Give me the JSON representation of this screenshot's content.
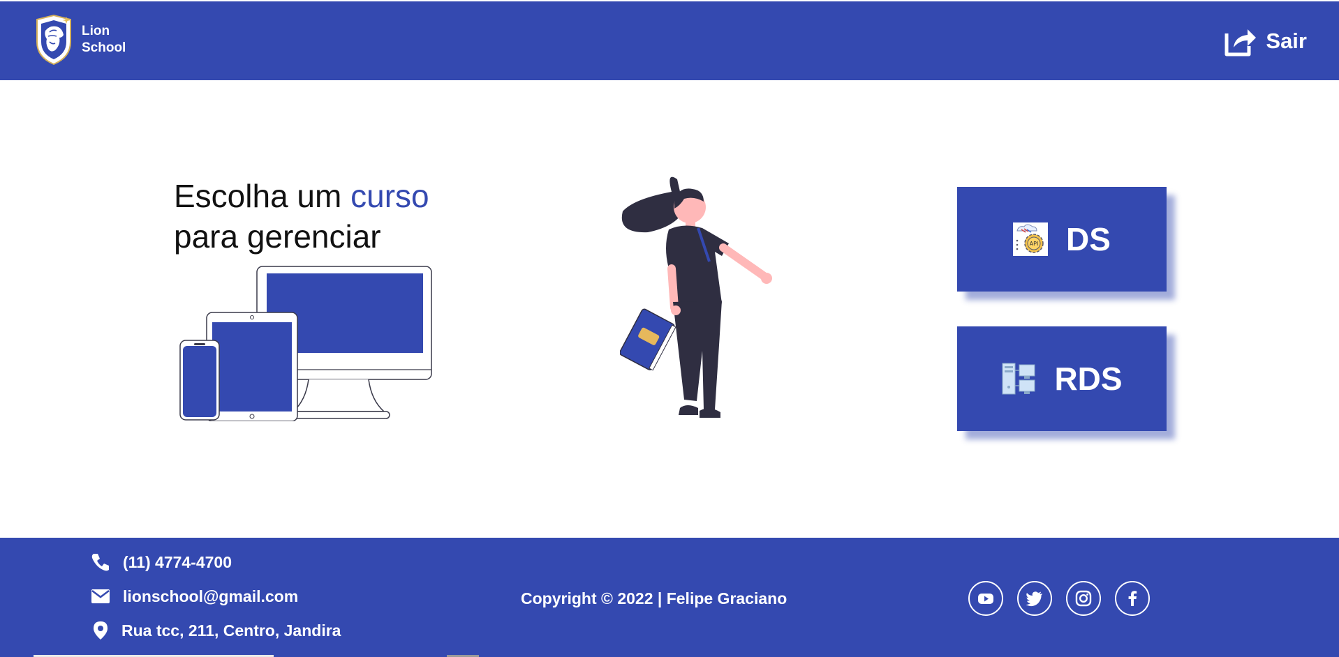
{
  "header": {
    "brand_line1": "Lion",
    "brand_line2": "School",
    "logout_label": "Sair"
  },
  "main": {
    "headline_part1": "Escolha um",
    "headline_accent": "curso",
    "headline_part2": "para gerenciar",
    "courses": [
      {
        "label": "DS",
        "icon": "api-gear-icon"
      },
      {
        "label": "RDS",
        "icon": "server-network-icon"
      }
    ]
  },
  "footer": {
    "phone": "(11) 4774-4700",
    "email": "lionschool@gmail.com",
    "address": "Rua tcc, 211, Centro, Jandira",
    "copyright": "Copyright © 2022 | Felipe Graciano",
    "socials": [
      "youtube-icon",
      "twitter-icon",
      "instagram-icon",
      "facebook-icon"
    ]
  },
  "colors": {
    "primary": "#3449b0",
    "text_dark": "#111111",
    "white": "#ffffff"
  }
}
